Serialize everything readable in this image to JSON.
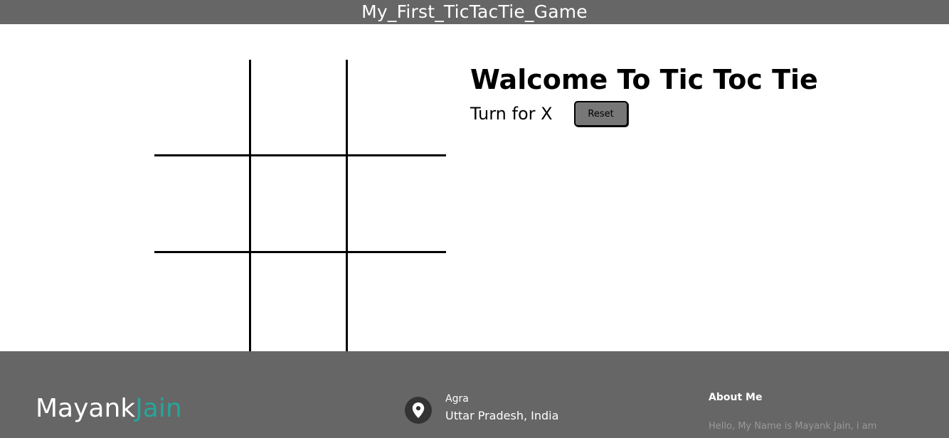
{
  "navbar": {
    "title": "My_First_TicTacTie_Game"
  },
  "board": {
    "cells": [
      "",
      "",
      "",
      "",
      "",
      "",
      "",
      "",
      ""
    ]
  },
  "game": {
    "heading": "Walcome To Tic Toc Tie",
    "turn_text": "Turn for X",
    "reset_label": "Reset"
  },
  "footer": {
    "brand_primary": "Mayank",
    "brand_accent": "Jain",
    "accent_color": "#26a69a",
    "location_icon": "map-pin-icon",
    "city": "Agra",
    "region": "Uttar Pradesh, India",
    "about_title": "About Me",
    "about_text": "Hello, My Name is Mayank Jain, i am"
  }
}
